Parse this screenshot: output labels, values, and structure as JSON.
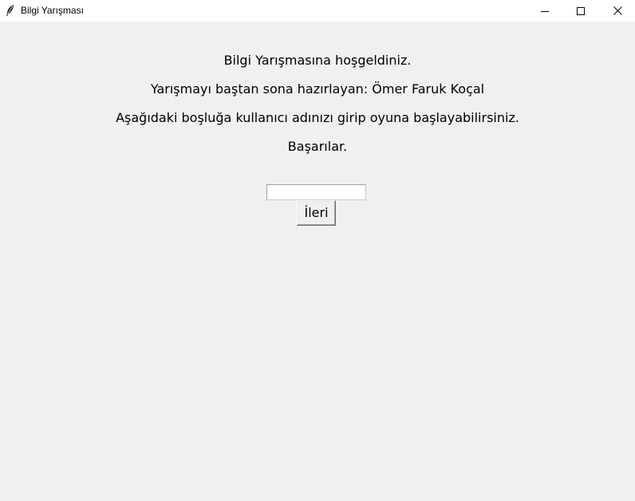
{
  "window": {
    "title": "Bilgi Yarışması",
    "icon": "feather-icon",
    "controls": [
      "minimize-icon",
      "maximize-icon",
      "close-icon"
    ]
  },
  "welcome": {
    "line1": "Bilgi Yarışmasına hoşgeldiniz.",
    "line2": "Yarışmayı baştan sona hazırlayan: Ömer Faruk Koçal",
    "line3": "Aşağıdaki boşluğa kullanıcı adınızı girip oyuna başlayabilirsiniz.",
    "line4": "Başarılar."
  },
  "form": {
    "username_value": "",
    "next_label": "İleri"
  },
  "colors": {
    "background": "#f0f0f0",
    "titlebar": "#ffffff",
    "text": "#000000"
  }
}
